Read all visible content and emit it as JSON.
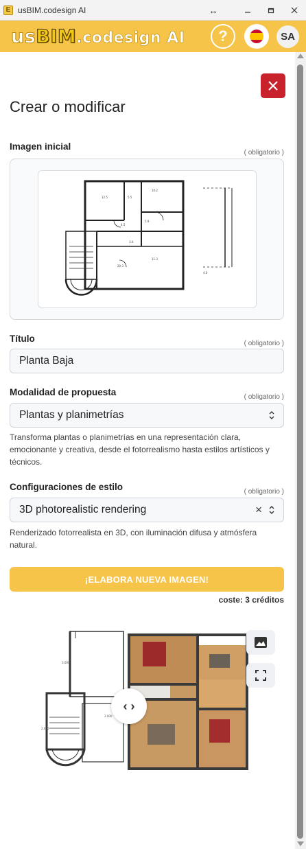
{
  "window": {
    "title": "usBIM.codesign AI",
    "icon_letter": "E"
  },
  "header": {
    "logo_us": "us",
    "logo_bim": "BIM",
    "logo_rest": ".codesign AI",
    "help_label": "?",
    "avatar_initials": "SA",
    "language": "es"
  },
  "page": {
    "title": "Crear o modificar"
  },
  "form": {
    "initial_image": {
      "label": "Imagen inicial",
      "required": "( obligatorio )"
    },
    "title_field": {
      "label": "Título",
      "required": "( obligatorio )",
      "value": "Planta Baja"
    },
    "mode_field": {
      "label": "Modalidad de propuesta",
      "required": "( obligatorio )",
      "value": "Plantas y planimetrías",
      "help": "Transforma plantas o planimetrías en una representación clara, emocionante y creativa, desde el fotorrealismo hasta estilos artísticos y técnicos."
    },
    "style_field": {
      "label": "Configuraciones de estilo",
      "required": "( obligatorio )",
      "value": "3D photorealistic rendering",
      "help": "Renderizado fotorrealista en 3D, con iluminación difusa y atmósfera natural."
    },
    "submit_label": "¡ELABORA NUEVA IMAGEN!",
    "cost": "coste: 3 créditos"
  },
  "colors": {
    "brand_yellow": "#f6c448",
    "close_red": "#c8232c"
  },
  "icons": {
    "close": "close-icon",
    "image": "image-icon",
    "fullscreen": "fullscreen-icon",
    "compare_handle": "compare-arrows-icon"
  }
}
